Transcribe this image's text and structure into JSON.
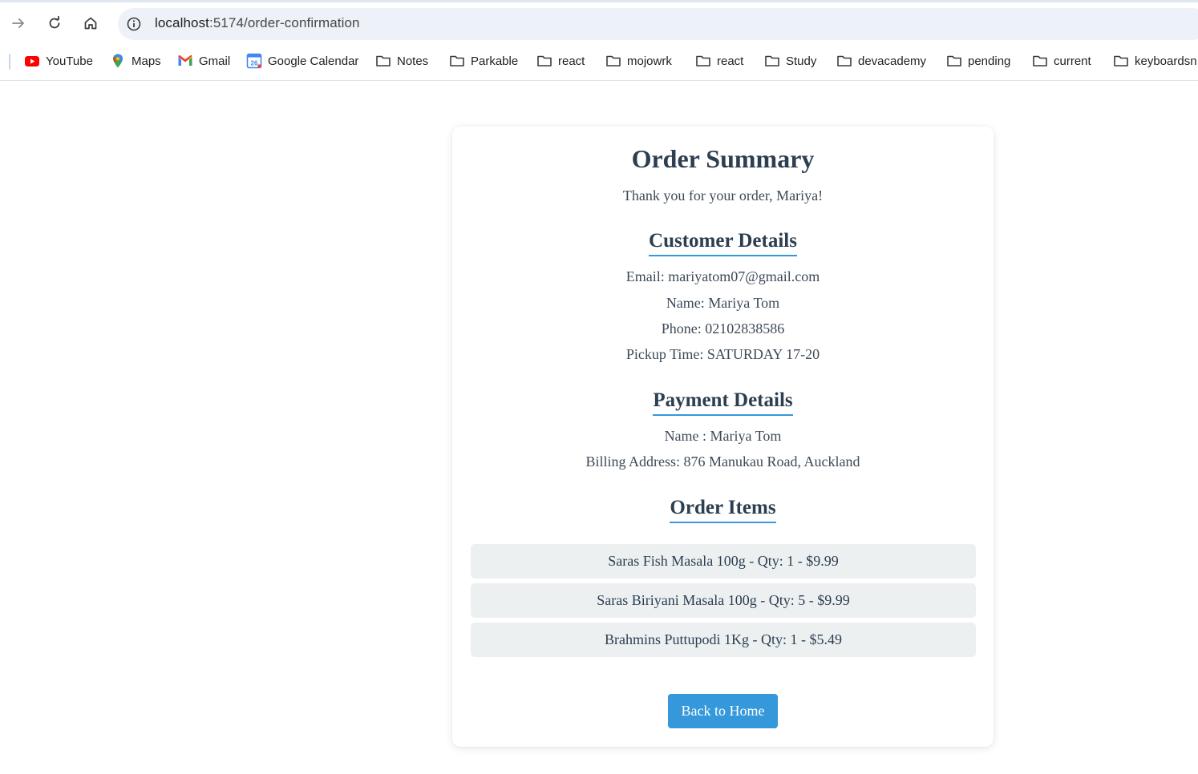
{
  "browser": {
    "url_host": "localhost",
    "url_path": ":5174/order-confirmation",
    "nav": {
      "forward_icon": "arrow-right-icon",
      "reload_icon": "reload-icon",
      "home_icon": "home-icon",
      "info_icon": "info-icon"
    },
    "bookmarks": [
      {
        "label": "YouTube",
        "icon": "youtube-icon"
      },
      {
        "label": "Maps",
        "icon": "maps-icon"
      },
      {
        "label": "Gmail",
        "icon": "gmail-icon"
      },
      {
        "label": "Google Calendar",
        "icon": "calendar-icon",
        "badge": "26"
      },
      {
        "label": "Notes",
        "icon": "folder-icon"
      },
      {
        "label": "Parkable",
        "icon": "folder-icon"
      },
      {
        "label": "react",
        "icon": "folder-icon"
      },
      {
        "label": "mojowrk",
        "icon": "folder-icon"
      },
      {
        "label": "react",
        "icon": "folder-icon"
      },
      {
        "label": "Study",
        "icon": "folder-icon"
      },
      {
        "label": "devacademy",
        "icon": "folder-icon"
      },
      {
        "label": "pending",
        "icon": "folder-icon"
      },
      {
        "label": "current",
        "icon": "folder-icon"
      },
      {
        "label": "keyboardsn",
        "icon": "folder-icon"
      }
    ]
  },
  "order": {
    "title": "Order Summary",
    "thanks": "Thank you for your order, Mariya!",
    "customer": {
      "heading": "Customer Details",
      "email": "Email: mariyatom07@gmail.com",
      "name": "Name: Mariya Tom",
      "phone": "Phone: 02102838586",
      "pickup": "Pickup Time: SATURDAY 17-20"
    },
    "payment": {
      "heading": "Payment Details",
      "name": "Name : Mariya Tom",
      "billing": "Billing Address: 876 Manukau Road, Auckland"
    },
    "items": {
      "heading": "Order Items",
      "list": [
        "Saras Fish Masala 100g - Qty: 1 - $9.99",
        "Saras Biriyani Masala 100g - Qty: 5 - $9.99",
        "Brahmins Puttupodi 1Kg - Qty: 1 - $5.49"
      ]
    },
    "back_button": "Back to Home"
  },
  "colors": {
    "accent": "#3498db",
    "heading": "#2c3e50",
    "item_bg": "#ecf0f1"
  }
}
